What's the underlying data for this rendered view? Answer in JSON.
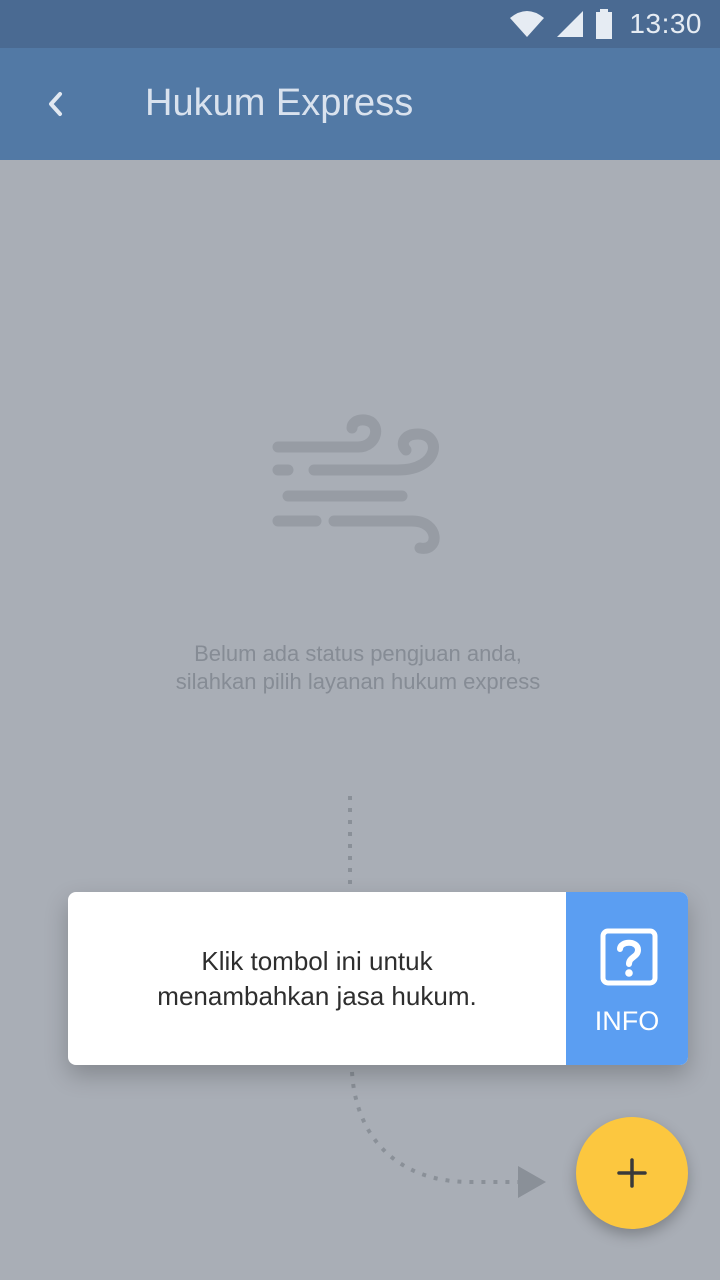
{
  "status_bar": {
    "time": "13:30",
    "icons": [
      "wifi-icon",
      "signal-icon",
      "battery-icon"
    ]
  },
  "app_bar": {
    "back_icon": "chevron-left-icon",
    "title": "Hukum Express"
  },
  "empty_state": {
    "icon": "wind-icon",
    "line1": "Belum ada status pengjuan anda,",
    "line2": "silahkan pilih layanan hukum express"
  },
  "tooltip": {
    "line1": "Klik tombol ini untuk",
    "line2": "menambahkan jasa hukum.",
    "info_icon": "question-box-icon",
    "info_label": "INFO"
  },
  "fab": {
    "icon": "plus-icon"
  },
  "colors": {
    "status_bar": "#4a6a92",
    "app_bar": "#5279a5",
    "overlay_bg": "#a9aeb6",
    "info_button": "#5b9ef2",
    "fab": "#fcc73f"
  }
}
